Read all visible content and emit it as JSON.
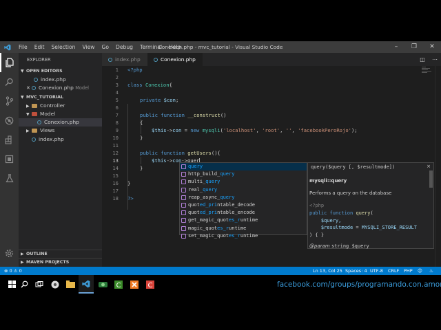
{
  "window": {
    "title": "Conexion.php - mvc_tutorial - Visual Studio Code",
    "menu": [
      "File",
      "Edit",
      "Selection",
      "View",
      "Go",
      "Debug",
      "Terminal",
      "Help"
    ]
  },
  "sidebar": {
    "title": "EXPLORER",
    "open_editors_label": "OPEN EDITORS",
    "open_editors": [
      {
        "name": "index.php",
        "hint": ""
      },
      {
        "name": "Conexion.php",
        "hint": "Model"
      }
    ],
    "project_label": "MVC_TUTORIAL",
    "tree": {
      "controller": "Controller",
      "model": "Model",
      "conexion": "Conexion.php",
      "views": "Views",
      "index": "index.php"
    },
    "outline_label": "OUTLINE",
    "maven_label": "MAVEN PROJECTS"
  },
  "tabs": [
    {
      "label": "index.php"
    },
    {
      "label": "Conexion.php"
    }
  ],
  "editor": {
    "line_numbers": [
      "1",
      "2",
      "3",
      "4",
      "5",
      "6",
      "7",
      "8",
      "9",
      "10",
      "11",
      "12",
      "13",
      "14",
      "15",
      "16",
      "17",
      "18"
    ],
    "current_line": 13,
    "code": {
      "l1_open": "<?php",
      "l3_kw": "class",
      "l3_name": "Conexion",
      "l3_brace": "{",
      "l5_kw": "private",
      "l5_var": "$con",
      "l5_semi": ";",
      "l7_kw1": "public",
      "l7_kw2": "function",
      "l7_fn": "__construct",
      "l7_paren": "()",
      "l8": "{",
      "l9_this": "$this",
      "l9_arrow": "->",
      "l9_prop": "con",
      "l9_eq": " = ",
      "l9_new": "new",
      "l9_cls": "mysqli",
      "l9_p1": "(",
      "l9_s1": "'localhost'",
      "l9_c1": ", ",
      "l9_s2": "'root'",
      "l9_c2": ", ",
      "l9_s3": "''",
      "l9_c3": ", ",
      "l9_s4": "'facebookPeroRojo'",
      "l9_end": ");",
      "l10": "}",
      "l12_kw1": "public",
      "l12_kw2": "function",
      "l12_fn": "getUsers",
      "l12_paren": "(){",
      "l13_this": "$this",
      "l13_arrow": "->",
      "l13_prop": "con",
      "l13_arrow2": "->",
      "l13_typed": "quer",
      "l14": "}",
      "l16": "}",
      "l18_close": "?>"
    }
  },
  "suggestions": [
    {
      "pre": "",
      "match": "query",
      "post": ""
    },
    {
      "pre": "http_build_",
      "match": "query",
      "post": ""
    },
    {
      "pre": "multi_",
      "match": "query",
      "post": ""
    },
    {
      "pre": "real_",
      "match": "query",
      "post": ""
    },
    {
      "pre": "reap_async_",
      "match": "query",
      "post": ""
    },
    {
      "pre": "quot",
      "match": "ed_pri",
      "post": "ntable_decode"
    },
    {
      "pre": "quot",
      "match": "ed_pri",
      "post": "ntable_encode"
    },
    {
      "pre": "get_magic_quot",
      "match": "es_r",
      "post": "untime"
    },
    {
      "pre": "magic_quot",
      "match": "es_r",
      "post": "untime"
    },
    {
      "pre": "set_magic_quot",
      "match": "es_r",
      "post": "untime"
    }
  ],
  "details": {
    "signature": "query($query [, $resultmode])",
    "close": "×",
    "name": "mysqli::query",
    "description": "Performs a query on the database",
    "code_line1": "<?php",
    "code_line2": "public function query(",
    "code_line3": "    $query,",
    "code_line4": "    $resultmode = MYSQLI_STORE_RESULT",
    "code_line5": ") { }",
    "param_tag": "@param",
    "param_text": "string $query"
  },
  "status": {
    "errors": "0",
    "warnings": "0",
    "position": "Ln 13, Col 25",
    "spaces": "Spaces: 4",
    "encoding": "UTF-8",
    "eol": "CRLF",
    "language": "PHP"
  },
  "taskbar": {
    "overlay_text": "facebook.com/groups/programando.con.amor"
  },
  "colors": {
    "accent": "#007acc",
    "editor_bg": "#1e1e1e",
    "sidebar_bg": "#252526",
    "keyword": "#569cd6",
    "string": "#ce9178",
    "function": "#dcdcaa",
    "variable": "#9cdcfe",
    "match_highlight": "#18a3ff"
  }
}
